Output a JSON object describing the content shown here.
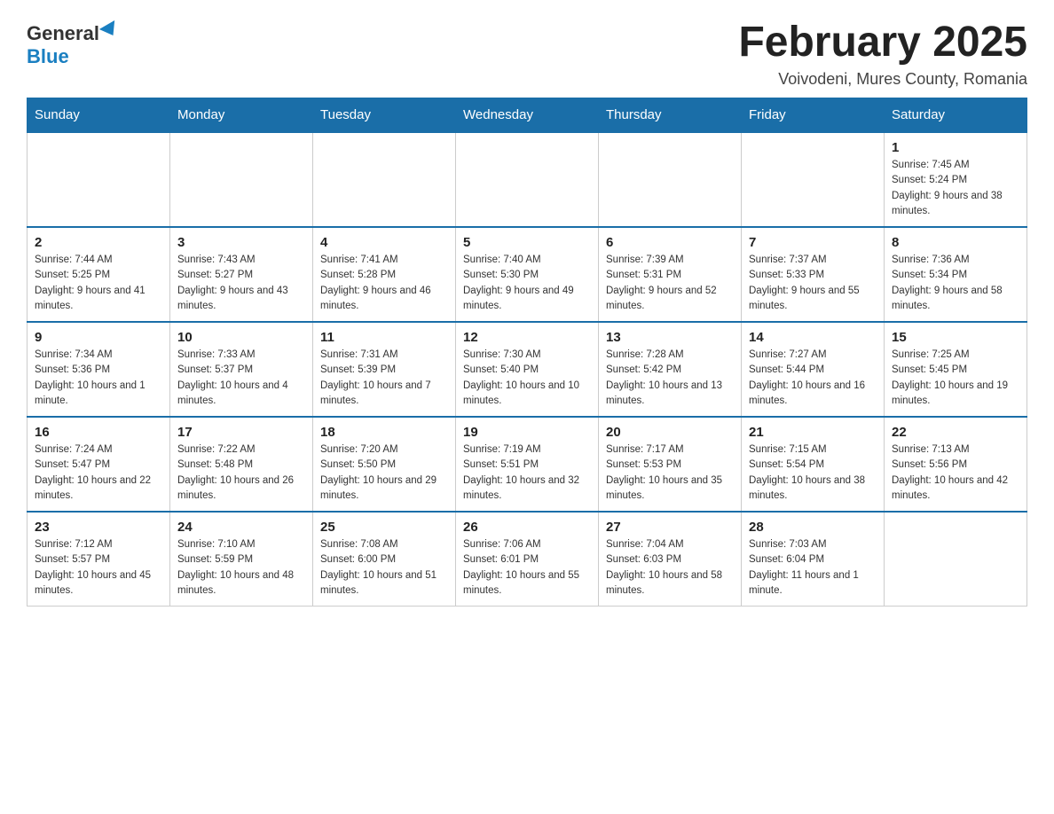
{
  "header": {
    "logo_general": "General",
    "logo_blue": "Blue",
    "month_title": "February 2025",
    "location": "Voivodeni, Mures County, Romania"
  },
  "days_of_week": [
    "Sunday",
    "Monday",
    "Tuesday",
    "Wednesday",
    "Thursday",
    "Friday",
    "Saturday"
  ],
  "weeks": [
    [
      {
        "day": "",
        "info": ""
      },
      {
        "day": "",
        "info": ""
      },
      {
        "day": "",
        "info": ""
      },
      {
        "day": "",
        "info": ""
      },
      {
        "day": "",
        "info": ""
      },
      {
        "day": "",
        "info": ""
      },
      {
        "day": "1",
        "info": "Sunrise: 7:45 AM\nSunset: 5:24 PM\nDaylight: 9 hours and 38 minutes."
      }
    ],
    [
      {
        "day": "2",
        "info": "Sunrise: 7:44 AM\nSunset: 5:25 PM\nDaylight: 9 hours and 41 minutes."
      },
      {
        "day": "3",
        "info": "Sunrise: 7:43 AM\nSunset: 5:27 PM\nDaylight: 9 hours and 43 minutes."
      },
      {
        "day": "4",
        "info": "Sunrise: 7:41 AM\nSunset: 5:28 PM\nDaylight: 9 hours and 46 minutes."
      },
      {
        "day": "5",
        "info": "Sunrise: 7:40 AM\nSunset: 5:30 PM\nDaylight: 9 hours and 49 minutes."
      },
      {
        "day": "6",
        "info": "Sunrise: 7:39 AM\nSunset: 5:31 PM\nDaylight: 9 hours and 52 minutes."
      },
      {
        "day": "7",
        "info": "Sunrise: 7:37 AM\nSunset: 5:33 PM\nDaylight: 9 hours and 55 minutes."
      },
      {
        "day": "8",
        "info": "Sunrise: 7:36 AM\nSunset: 5:34 PM\nDaylight: 9 hours and 58 minutes."
      }
    ],
    [
      {
        "day": "9",
        "info": "Sunrise: 7:34 AM\nSunset: 5:36 PM\nDaylight: 10 hours and 1 minute."
      },
      {
        "day": "10",
        "info": "Sunrise: 7:33 AM\nSunset: 5:37 PM\nDaylight: 10 hours and 4 minutes."
      },
      {
        "day": "11",
        "info": "Sunrise: 7:31 AM\nSunset: 5:39 PM\nDaylight: 10 hours and 7 minutes."
      },
      {
        "day": "12",
        "info": "Sunrise: 7:30 AM\nSunset: 5:40 PM\nDaylight: 10 hours and 10 minutes."
      },
      {
        "day": "13",
        "info": "Sunrise: 7:28 AM\nSunset: 5:42 PM\nDaylight: 10 hours and 13 minutes."
      },
      {
        "day": "14",
        "info": "Sunrise: 7:27 AM\nSunset: 5:44 PM\nDaylight: 10 hours and 16 minutes."
      },
      {
        "day": "15",
        "info": "Sunrise: 7:25 AM\nSunset: 5:45 PM\nDaylight: 10 hours and 19 minutes."
      }
    ],
    [
      {
        "day": "16",
        "info": "Sunrise: 7:24 AM\nSunset: 5:47 PM\nDaylight: 10 hours and 22 minutes."
      },
      {
        "day": "17",
        "info": "Sunrise: 7:22 AM\nSunset: 5:48 PM\nDaylight: 10 hours and 26 minutes."
      },
      {
        "day": "18",
        "info": "Sunrise: 7:20 AM\nSunset: 5:50 PM\nDaylight: 10 hours and 29 minutes."
      },
      {
        "day": "19",
        "info": "Sunrise: 7:19 AM\nSunset: 5:51 PM\nDaylight: 10 hours and 32 minutes."
      },
      {
        "day": "20",
        "info": "Sunrise: 7:17 AM\nSunset: 5:53 PM\nDaylight: 10 hours and 35 minutes."
      },
      {
        "day": "21",
        "info": "Sunrise: 7:15 AM\nSunset: 5:54 PM\nDaylight: 10 hours and 38 minutes."
      },
      {
        "day": "22",
        "info": "Sunrise: 7:13 AM\nSunset: 5:56 PM\nDaylight: 10 hours and 42 minutes."
      }
    ],
    [
      {
        "day": "23",
        "info": "Sunrise: 7:12 AM\nSunset: 5:57 PM\nDaylight: 10 hours and 45 minutes."
      },
      {
        "day": "24",
        "info": "Sunrise: 7:10 AM\nSunset: 5:59 PM\nDaylight: 10 hours and 48 minutes."
      },
      {
        "day": "25",
        "info": "Sunrise: 7:08 AM\nSunset: 6:00 PM\nDaylight: 10 hours and 51 minutes."
      },
      {
        "day": "26",
        "info": "Sunrise: 7:06 AM\nSunset: 6:01 PM\nDaylight: 10 hours and 55 minutes."
      },
      {
        "day": "27",
        "info": "Sunrise: 7:04 AM\nSunset: 6:03 PM\nDaylight: 10 hours and 58 minutes."
      },
      {
        "day": "28",
        "info": "Sunrise: 7:03 AM\nSunset: 6:04 PM\nDaylight: 11 hours and 1 minute."
      },
      {
        "day": "",
        "info": ""
      }
    ]
  ]
}
